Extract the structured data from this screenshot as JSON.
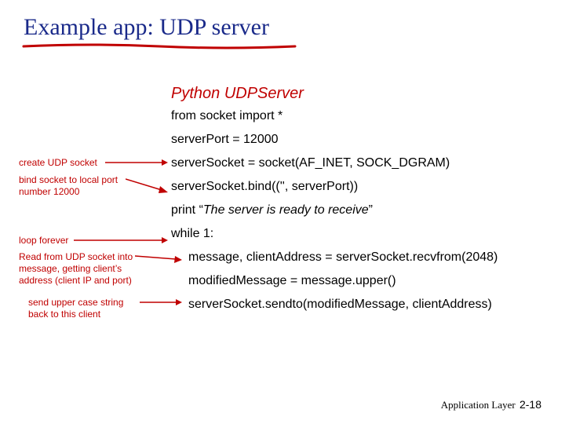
{
  "title": "Example app: UDP server",
  "subtitle": "Python UDPServer",
  "code": {
    "l1": "from socket import *",
    "l2": "serverPort = 12000",
    "l3": "serverSocket = socket(AF_INET, SOCK_DGRAM)",
    "l4": "serverSocket.bind(('', serverPort))",
    "l5a": "print “",
    "l5b": "The server is ready to receive",
    "l5c": "”",
    "l6": "while 1:",
    "l7": "message, clientAddress = serverSocket.recvfrom(2048)",
    "l8": "modifiedMessage = message.upper()",
    "l9": "serverSocket.sendto(modifiedMessage, clientAddress)"
  },
  "anno": {
    "a1": "create UDP socket",
    "a2": "bind socket to local port number 12000",
    "a3": "loop forever",
    "a4": "Read from UDP socket into message, getting client’s address (client IP and port)",
    "a5": "send upper case string back to this client"
  },
  "footer": {
    "label": "Application Layer",
    "page": "2-18"
  }
}
